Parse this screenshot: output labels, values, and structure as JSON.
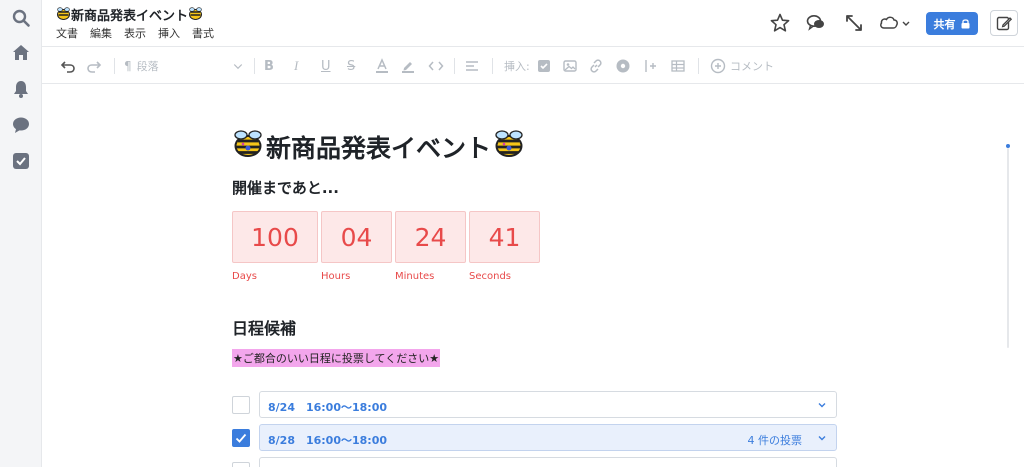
{
  "document": {
    "title": "新商品発表イベント",
    "menu": [
      "文書",
      "編集",
      "表示",
      "挿入",
      "書式"
    ]
  },
  "header": {
    "share_label": "共有"
  },
  "toolbar": {
    "paragraph_label": "段落",
    "insert_label": "挿入:",
    "comment_label": "コメント"
  },
  "content": {
    "heading": "新商品発表イベント",
    "subheading": "開催まであと...",
    "countdown": [
      {
        "value": "100",
        "label": "Days"
      },
      {
        "value": "04",
        "label": "Hours"
      },
      {
        "value": "24",
        "label": "Minutes"
      },
      {
        "value": "41",
        "label": "Seconds"
      }
    ],
    "section_title": "日程候補",
    "highlight_text": "★ご都合のいい日程に投票してください★",
    "poll_options": [
      {
        "text": "8/24　16:00〜18:00",
        "count": "",
        "checked": false
      },
      {
        "text": "8/28　16:00〜18:00",
        "count": "4 件の投票",
        "checked": true
      }
    ]
  },
  "colors": {
    "accent": "#3b7ddd",
    "countdown_text": "#e84a4a",
    "countdown_bg": "#fde8e8",
    "highlight_bg": "#f3a6ec"
  }
}
